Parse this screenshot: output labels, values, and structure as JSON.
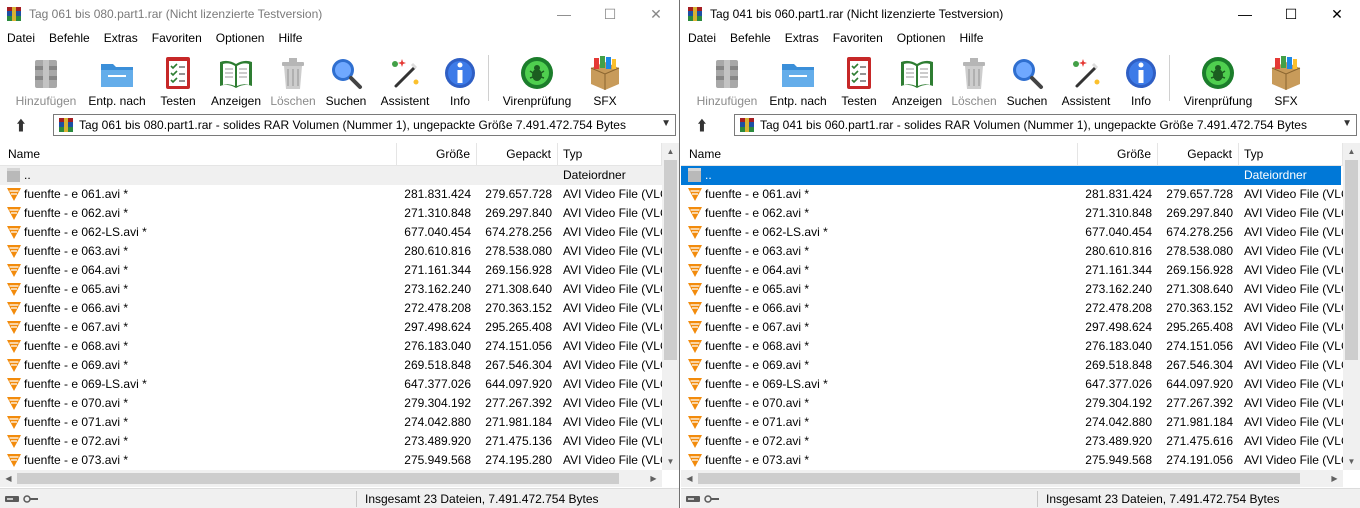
{
  "windows": [
    {
      "id": "left",
      "title": "Tag 061 bis 080.part1.rar (Nicht lizenzierte Testversion)",
      "menu": [
        "Datei",
        "Befehle",
        "Extras",
        "Favoriten",
        "Optionen",
        "Hilfe"
      ],
      "toolbar": [
        {
          "label": "Hinzufügen",
          "icon": "archive-add-icon",
          "enabled": false
        },
        {
          "label": "Entp. nach",
          "icon": "folder-extract-icon",
          "enabled": true
        },
        {
          "label": "Testen",
          "icon": "test-checklist-icon",
          "enabled": true
        },
        {
          "label": "Anzeigen",
          "icon": "open-book-icon",
          "enabled": true
        },
        {
          "label": "Löschen",
          "icon": "trash-can-icon",
          "enabled": false
        },
        {
          "label": "Suchen",
          "icon": "magnifier-icon",
          "enabled": true
        },
        {
          "label": "Assistent",
          "icon": "magic-wand-icon",
          "enabled": true
        },
        {
          "label": "Info",
          "icon": "info-icon",
          "enabled": true
        },
        {
          "label": "Virenprüfung",
          "icon": "virus-scan-icon",
          "enabled": true
        },
        {
          "label": "SFX",
          "icon": "sfx-box-icon",
          "enabled": true
        }
      ],
      "path": "Tag 061 bis 080.part1.rar - solides RAR Volumen (Nummer 1), ungepackte Größe 7.491.472.754 Bytes",
      "columns": {
        "name": "Name",
        "size": "Größe",
        "packed": "Gepackt",
        "type": "Typ"
      },
      "parent_row": {
        "name": "..",
        "type": "Dateiordner",
        "selected": false
      },
      "files": [
        {
          "name": "fuenfte - e  061.avi *",
          "size": "281.831.424",
          "packed": "279.657.728",
          "type": "AVI Video File (VLC"
        },
        {
          "name": "fuenfte - e  062.avi *",
          "size": "271.310.848",
          "packed": "269.297.840",
          "type": "AVI Video File (VLC"
        },
        {
          "name": "fuenfte - e  062-LS.avi *",
          "size": "677.040.454",
          "packed": "674.278.256",
          "type": "AVI Video File (VLC"
        },
        {
          "name": "fuenfte - e  063.avi *",
          "size": "280.610.816",
          "packed": "278.538.080",
          "type": "AVI Video File (VLC"
        },
        {
          "name": "fuenfte - e  064.avi *",
          "size": "271.161.344",
          "packed": "269.156.928",
          "type": "AVI Video File (VLC"
        },
        {
          "name": "fuenfte - e  065.avi *",
          "size": "273.162.240",
          "packed": "271.308.640",
          "type": "AVI Video File (VLC"
        },
        {
          "name": "fuenfte - e  066.avi *",
          "size": "272.478.208",
          "packed": "270.363.152",
          "type": "AVI Video File (VLC"
        },
        {
          "name": "fuenfte - e  067.avi *",
          "size": "297.498.624",
          "packed": "295.265.408",
          "type": "AVI Video File (VLC"
        },
        {
          "name": "fuenfte - e  068.avi *",
          "size": "276.183.040",
          "packed": "274.151.056",
          "type": "AVI Video File (VLC"
        },
        {
          "name": "fuenfte - e  069.avi *",
          "size": "269.518.848",
          "packed": "267.546.304",
          "type": "AVI Video File (VLC"
        },
        {
          "name": "fuenfte - e  069-LS.avi *",
          "size": "647.377.026",
          "packed": "644.097.920",
          "type": "AVI Video File (VLC"
        },
        {
          "name": "fuenfte - e  070.avi *",
          "size": "279.304.192",
          "packed": "277.267.392",
          "type": "AVI Video File (VLC"
        },
        {
          "name": "fuenfte - e  071.avi *",
          "size": "274.042.880",
          "packed": "271.981.184",
          "type": "AVI Video File (VLC"
        },
        {
          "name": "fuenfte - e  072.avi *",
          "size": "273.489.920",
          "packed": "271.475.136",
          "type": "AVI Video File (VLC"
        },
        {
          "name": "fuenfte - e  073.avi *",
          "size": "275.949.568",
          "packed": "274.195.280",
          "type": "AVI Video File (VLC"
        }
      ],
      "status": "Insgesamt 23 Dateien, 7.491.472.754 Bytes"
    },
    {
      "id": "right",
      "title": "Tag 041 bis 060.part1.rar (Nicht lizenzierte Testversion)",
      "menu": [
        "Datei",
        "Befehle",
        "Extras",
        "Favoriten",
        "Optionen",
        "Hilfe"
      ],
      "toolbar": [
        {
          "label": "Hinzufügen",
          "icon": "archive-add-icon",
          "enabled": false
        },
        {
          "label": "Entp. nach",
          "icon": "folder-extract-icon",
          "enabled": true
        },
        {
          "label": "Testen",
          "icon": "test-checklist-icon",
          "enabled": true
        },
        {
          "label": "Anzeigen",
          "icon": "open-book-icon",
          "enabled": true
        },
        {
          "label": "Löschen",
          "icon": "trash-can-icon",
          "enabled": false
        },
        {
          "label": "Suchen",
          "icon": "magnifier-icon",
          "enabled": true
        },
        {
          "label": "Assistent",
          "icon": "magic-wand-icon",
          "enabled": true
        },
        {
          "label": "Info",
          "icon": "info-icon",
          "enabled": true
        },
        {
          "label": "Virenprüfung",
          "icon": "virus-scan-icon",
          "enabled": true
        },
        {
          "label": "SFX",
          "icon": "sfx-box-icon",
          "enabled": true
        }
      ],
      "path": "Tag 041 bis 060.part1.rar - solides RAR Volumen (Nummer 1), ungepackte Größe 7.491.472.754 Bytes",
      "columns": {
        "name": "Name",
        "size": "Größe",
        "packed": "Gepackt",
        "type": "Typ"
      },
      "parent_row": {
        "name": "..",
        "type": "Dateiordner",
        "selected": true
      },
      "files": [
        {
          "name": "fuenfte - e  061.avi *",
          "size": "281.831.424",
          "packed": "279.657.728",
          "type": "AVI Video File (VLC"
        },
        {
          "name": "fuenfte - e  062.avi *",
          "size": "271.310.848",
          "packed": "269.297.840",
          "type": "AVI Video File (VLC"
        },
        {
          "name": "fuenfte - e  062-LS.avi *",
          "size": "677.040.454",
          "packed": "674.278.256",
          "type": "AVI Video File (VLC"
        },
        {
          "name": "fuenfte - e  063.avi *",
          "size": "280.610.816",
          "packed": "278.538.080",
          "type": "AVI Video File (VLC"
        },
        {
          "name": "fuenfte - e  064.avi *",
          "size": "271.161.344",
          "packed": "269.156.928",
          "type": "AVI Video File (VLC"
        },
        {
          "name": "fuenfte - e  065.avi *",
          "size": "273.162.240",
          "packed": "271.308.640",
          "type": "AVI Video File (VLC"
        },
        {
          "name": "fuenfte - e  066.avi *",
          "size": "272.478.208",
          "packed": "270.363.152",
          "type": "AVI Video File (VLC"
        },
        {
          "name": "fuenfte - e  067.avi *",
          "size": "297.498.624",
          "packed": "295.265.408",
          "type": "AVI Video File (VLC"
        },
        {
          "name": "fuenfte - e  068.avi *",
          "size": "276.183.040",
          "packed": "274.151.056",
          "type": "AVI Video File (VLC"
        },
        {
          "name": "fuenfte - e  069.avi *",
          "size": "269.518.848",
          "packed": "267.546.304",
          "type": "AVI Video File (VLC"
        },
        {
          "name": "fuenfte - e  069-LS.avi *",
          "size": "647.377.026",
          "packed": "644.097.920",
          "type": "AVI Video File (VLC"
        },
        {
          "name": "fuenfte - e  070.avi *",
          "size": "279.304.192",
          "packed": "277.267.392",
          "type": "AVI Video File (VLC"
        },
        {
          "name": "fuenfte - e  071.avi *",
          "size": "274.042.880",
          "packed": "271.981.184",
          "type": "AVI Video File (VLC"
        },
        {
          "name": "fuenfte - e  072.avi *",
          "size": "273.489.920",
          "packed": "271.475.616",
          "type": "AVI Video File (VLC"
        },
        {
          "name": "fuenfte - e  073.avi *",
          "size": "275.949.568",
          "packed": "274.191.056",
          "type": "AVI Video File (VLC"
        }
      ],
      "status": "Insgesamt 23 Dateien, 7.491.472.754 Bytes"
    }
  ],
  "colors": {
    "selection": "#0078d7",
    "vlc_orange": "#f28b0c",
    "winrar_red": "#a41e22"
  }
}
